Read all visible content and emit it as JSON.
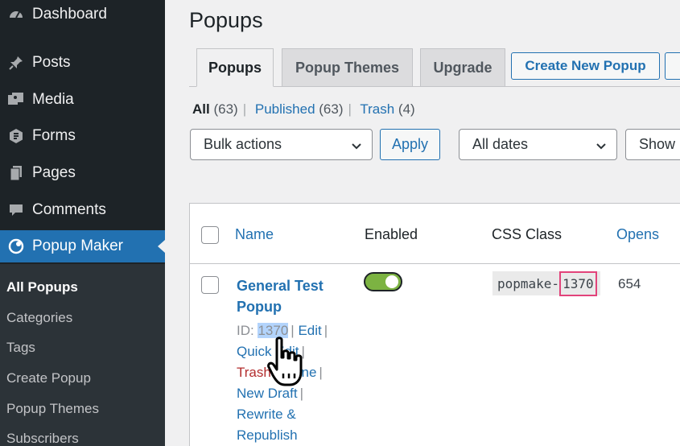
{
  "sidebar": {
    "items": [
      {
        "label": "Dashboard",
        "icon": "dashboard-icon"
      },
      {
        "label": "Posts",
        "icon": "pin-icon"
      },
      {
        "label": "Media",
        "icon": "media-icon"
      },
      {
        "label": "Forms",
        "icon": "forms-icon"
      },
      {
        "label": "Pages",
        "icon": "pages-icon"
      },
      {
        "label": "Comments",
        "icon": "comment-icon"
      },
      {
        "label": "Popup Maker",
        "icon": "popup-maker-icon"
      }
    ],
    "submenu": [
      "All Popups",
      "Categories",
      "Tags",
      "Create Popup",
      "Popup Themes",
      "Subscribers"
    ]
  },
  "page": {
    "title": "Popups",
    "tabs": [
      "Popups",
      "Popup Themes",
      "Upgrade"
    ],
    "create_new_label": "Create New Popup"
  },
  "filters": {
    "all": "All",
    "all_count": "(63)",
    "published": "Published",
    "published_count": "(63)",
    "trash": "Trash",
    "trash_count": "(4)",
    "bulk_actions": "Bulk actions",
    "apply": "Apply",
    "dates": "All dates",
    "show": "Show"
  },
  "table": {
    "columns": {
      "name": "Name",
      "enabled": "Enabled",
      "css_class": "CSS Class",
      "opens": "Opens"
    },
    "row": {
      "title": "General Test Popup",
      "id_label": "ID:",
      "id": "1370",
      "actions": {
        "edit": "Edit",
        "quick_edit": "Quick Edit",
        "trash": "Trash",
        "clone": "Clone",
        "new_draft": "New Draft",
        "rewrite_line1": "Rewrite &",
        "rewrite_line2": "Republish"
      },
      "enabled": true,
      "css_prefix": "popmake-",
      "css_id": "1370",
      "opens": "654"
    }
  },
  "colors": {
    "accent": "#2271b1",
    "sidebar_bg": "#1d2327",
    "toggle_on": "#7cb342",
    "highlight_box": "#e2437a"
  }
}
